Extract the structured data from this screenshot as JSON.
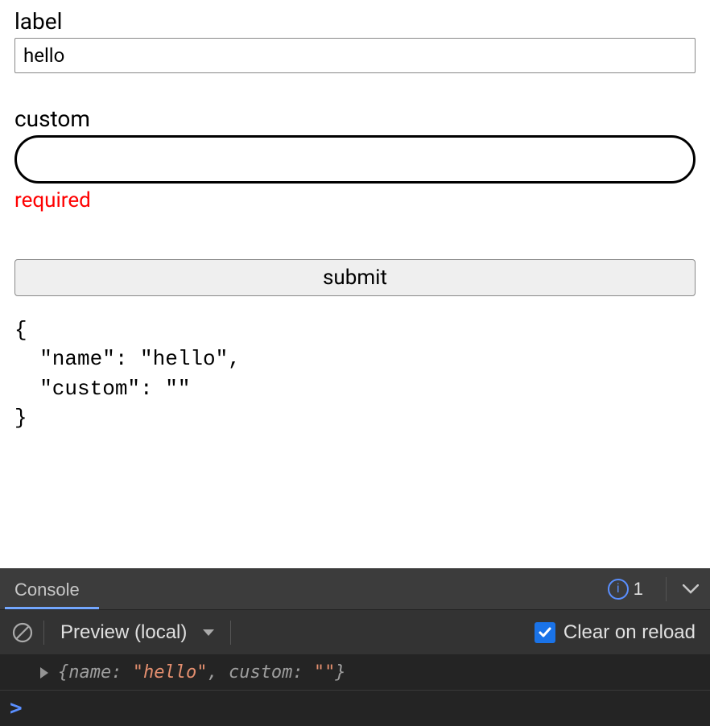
{
  "form": {
    "field1": {
      "label": "label",
      "value": "hello"
    },
    "field2": {
      "label": "custom",
      "value": "",
      "error": "required"
    },
    "submit_label": "submit"
  },
  "output_json": "{\n  \"name\": \"hello\",\n  \"custom\": \"\"\n}",
  "devtools": {
    "tab": "Console",
    "info_count": "1",
    "context": "Preview (local)",
    "clear_on_reload_label": "Clear on reload",
    "clear_on_reload_checked": true,
    "log": {
      "open_brace": "{",
      "k1": "name: ",
      "v1": "\"hello\"",
      "sep": ", ",
      "k2": "custom: ",
      "v2": "\"\"",
      "close_brace": "}"
    },
    "prompt": ">"
  }
}
